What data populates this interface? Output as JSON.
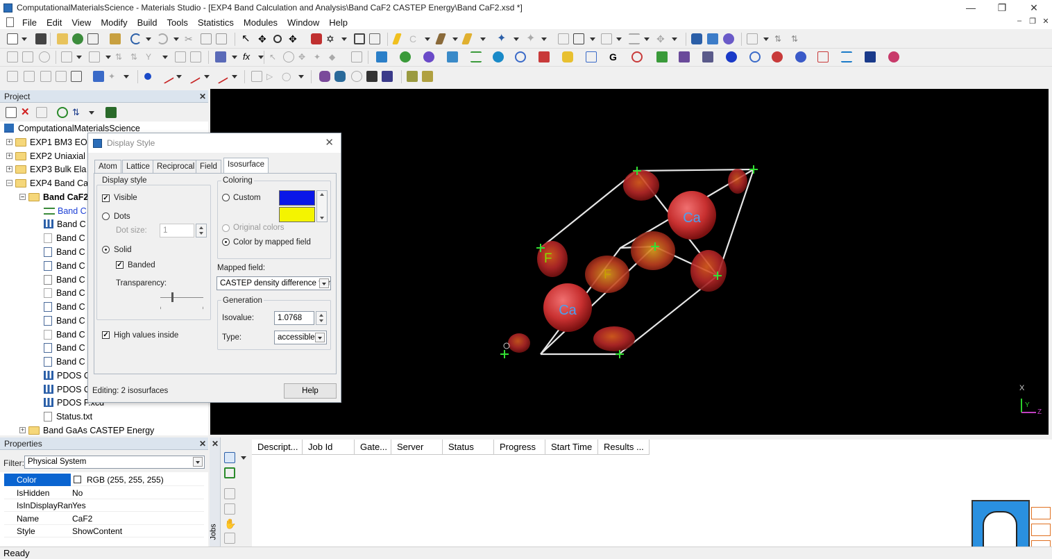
{
  "window": {
    "title": "ComputationalMaterialsScience - Materials Studio - [EXP4 Band Calculation and Analysis\\Band CaF2 CASTEP Energy\\Band CaF2.xsd *]"
  },
  "menu": [
    "File",
    "Edit",
    "View",
    "Modify",
    "Build",
    "Tools",
    "Statistics",
    "Modules",
    "Window",
    "Help"
  ],
  "project": {
    "header": "Project",
    "root": "ComputationalMaterialsScience",
    "items": [
      {
        "label": "EXP1 BM3 EO"
      },
      {
        "label": "EXP2 Uniaxial"
      },
      {
        "label": "EXP3 Bulk Ela"
      },
      {
        "label": "EXP4 Band Ca"
      },
      {
        "label": "Band CaF2"
      },
      {
        "label": "Band C"
      },
      {
        "label": "Band C"
      },
      {
        "label": "Band C"
      },
      {
        "label": "Band C"
      },
      {
        "label": "Band C"
      },
      {
        "label": "Band C"
      },
      {
        "label": "Band C"
      },
      {
        "label": "Band C"
      },
      {
        "label": "Band C"
      },
      {
        "label": "Band C"
      },
      {
        "label": "Band C"
      },
      {
        "label": "Band C"
      },
      {
        "label": "PDOS C"
      },
      {
        "label": "PDOS C"
      },
      {
        "label": "PDOS F.xcd"
      },
      {
        "label": "Status.txt"
      },
      {
        "label": "Band GaAs CASTEP Energy"
      }
    ]
  },
  "dialog": {
    "title": "Display Style",
    "tabs": [
      "Atom",
      "Lattice",
      "Reciprocal",
      "Field",
      "Isosurface"
    ],
    "display_style": {
      "group": "Display style",
      "visible": "Visible",
      "dots": "Dots",
      "dot_size_label": "Dot size:",
      "dot_size_value": "1",
      "solid": "Solid",
      "banded": "Banded",
      "transparency": "Transparency:"
    },
    "high_values": "High values inside",
    "coloring": {
      "group": "Coloring",
      "custom": "Custom",
      "original": "Original colors",
      "mapped": "Color by mapped field",
      "color1": "#0a17e8",
      "color2": "#f4f400"
    },
    "mapped_field_label": "Mapped field:",
    "mapped_field_value": "CASTEP density difference fror",
    "generation": {
      "group": "Generation",
      "isovalue_label": "Isovalue:",
      "isovalue": "1.0768",
      "type_label": "Type:",
      "type": "accessible"
    },
    "editing": "Editing: 2 isosurfaces",
    "help": "Help"
  },
  "viewer": {
    "labels": [
      "Ca",
      "Ca",
      "F",
      "F"
    ],
    "axes": [
      "X",
      "Y",
      "Z"
    ]
  },
  "properties": {
    "header": "Properties",
    "filter_label": "Filter:",
    "filter_value": "Physical System",
    "rows": [
      {
        "key": "Color",
        "value": "RGB (255, 255, 255)"
      },
      {
        "key": "IsHidden",
        "value": "No"
      },
      {
        "key": "IsInDisplayRan",
        "value": "Yes"
      },
      {
        "key": "Name",
        "value": "CaF2"
      },
      {
        "key": "Style",
        "value": "ShowContent"
      }
    ]
  },
  "jobs": {
    "side_label": "Jobs",
    "columns": [
      "Descript...",
      "Job Id",
      "Gate...",
      "Server",
      "Status",
      "Progress",
      "Start Time",
      "Results ..."
    ]
  },
  "status": {
    "text": "Ready"
  }
}
